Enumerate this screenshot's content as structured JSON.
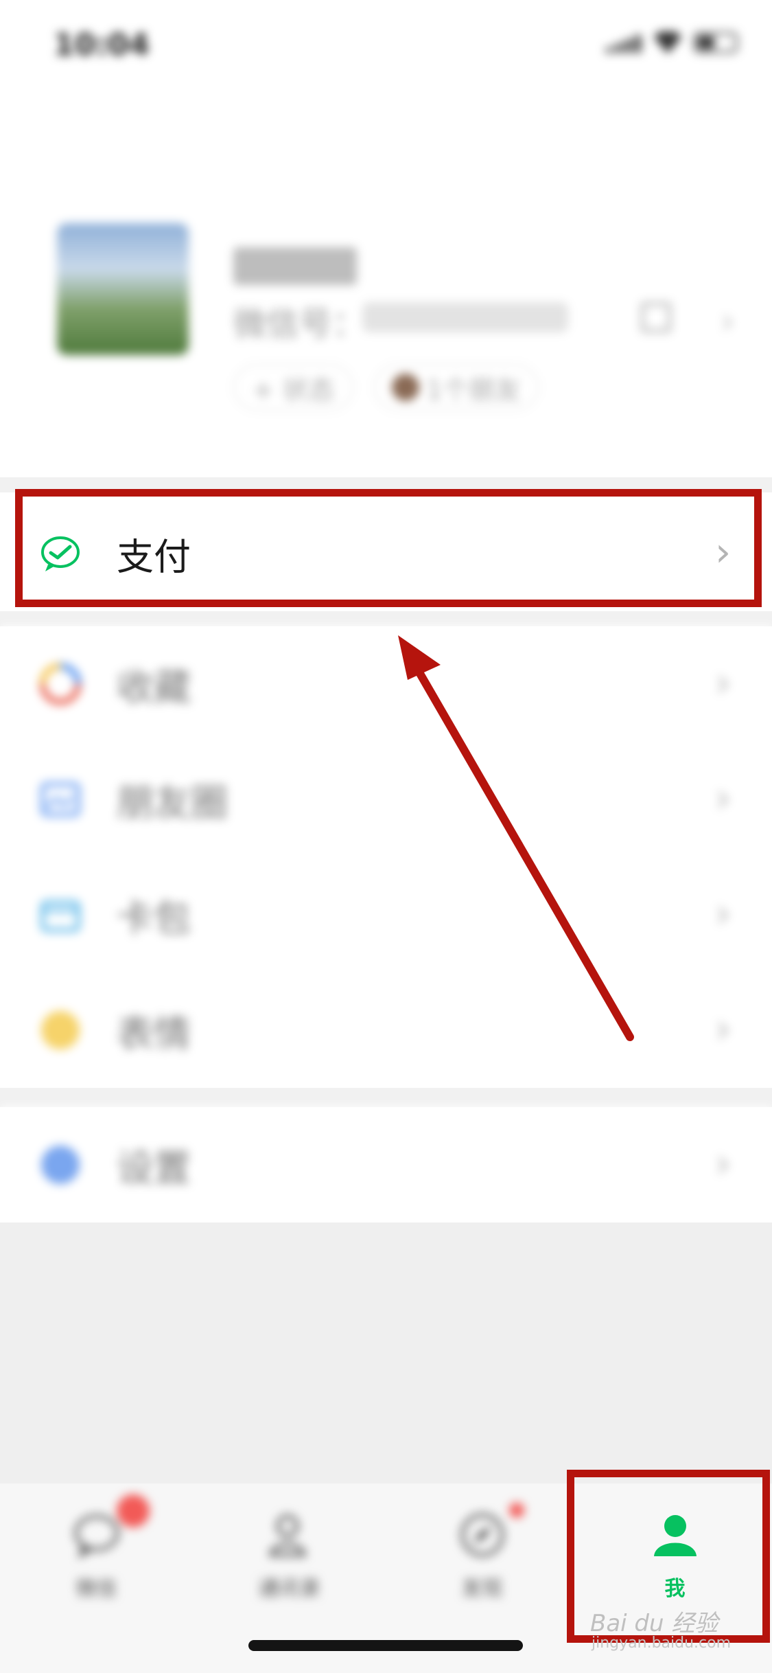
{
  "status_bar": {
    "time": "10:04"
  },
  "profile": {
    "wechat_id_label": "微信号：",
    "status_chip": "+ 状态",
    "friends_chip": "1个朋友"
  },
  "menu": {
    "pay": "支付",
    "favorites": "收藏",
    "moments": "朋友圈",
    "cards": "卡包",
    "stickers": "表情",
    "settings": "设置"
  },
  "tabbar": {
    "chats": "微信",
    "contacts": "通讯录",
    "discover": "发现",
    "me": "我"
  },
  "watermark": {
    "main": "Bai du 经验",
    "sub": "jingyan.baidu.com"
  },
  "colors": {
    "accent_green": "#07c160",
    "highlight_red": "#b5140d",
    "badge_red": "#f25a57"
  }
}
